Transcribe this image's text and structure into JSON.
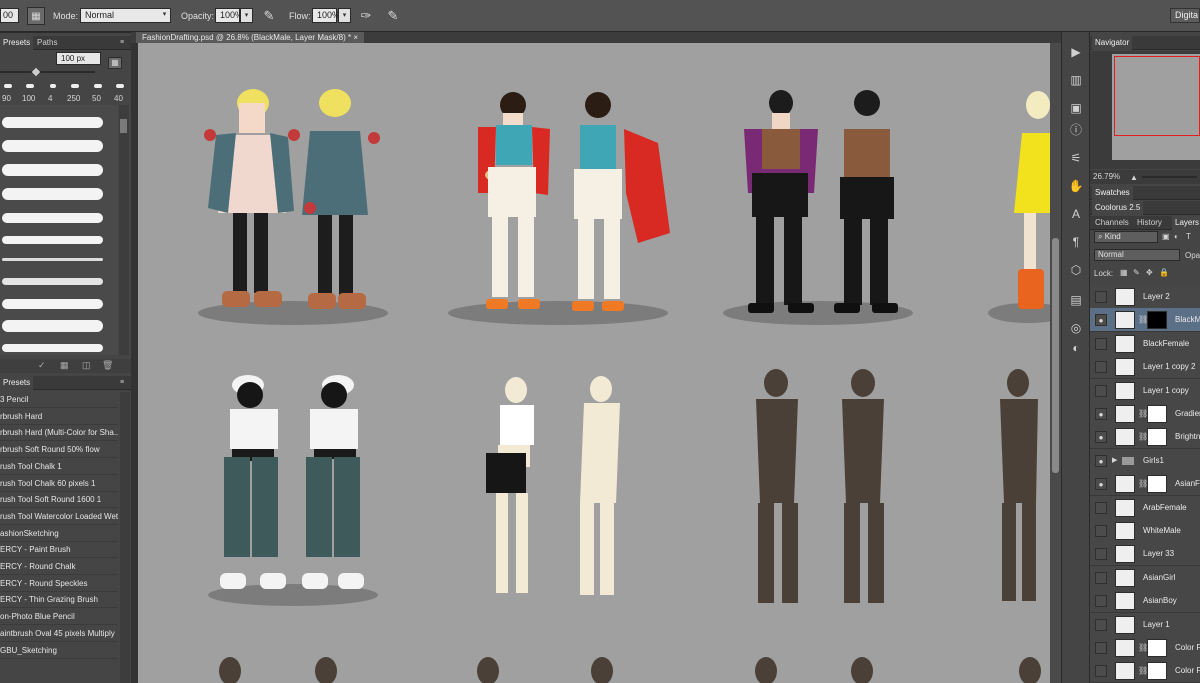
{
  "options_bar": {
    "brush_size": "00",
    "mode_label": "Mode:",
    "mode_value": "Normal",
    "opacity_label": "Opacity:",
    "opacity_value": "100%",
    "flow_label": "Flow:",
    "flow_value": "100%",
    "workspace": "Digita"
  },
  "brush_presets_panel": {
    "tabs": [
      "Presets",
      "Paths"
    ],
    "size_value": "100 px",
    "size_numbers": [
      "90",
      "100",
      "4",
      "250",
      "50",
      "40"
    ]
  },
  "tool_presets_panel": {
    "tab": "Presets",
    "items": [
      "3 Pencil",
      "rbrush Hard",
      "rbrush Hard (Multi-Color for Sha...",
      "rbrush Soft Round 50% flow",
      "rush Tool Chalk 1",
      "rush Tool Chalk 60 pixels 1",
      "rush Tool Soft Round 1600 1",
      "rush Tool Watercolor Loaded Wet...",
      "ashionSketching",
      "ERCY - Paint Brush",
      "ERCY - Round Chalk",
      "ERCY - Round Speckles",
      "ERCY - Thin Grazing Brush",
      "on-Photo Blue Pencil",
      "aintbrush Oval 45 pixels Multiply",
      "GBU_Sketching"
    ]
  },
  "document": {
    "tab_title": "FashionDrafting.psd @ 26.8% (BlackMale, Layer Mask/8) *",
    "close": "×"
  },
  "navigator": {
    "title": "Navigator",
    "zoom": "26.79%"
  },
  "swatches": {
    "title": "Swatches"
  },
  "coolorus": {
    "title": "Coolorus 2.5"
  },
  "layers_panel": {
    "tabs": [
      "Channels",
      "History",
      "Layers"
    ],
    "filter": "Kind",
    "blend_mode": "Normal",
    "opacity_label": "Opa",
    "lock_label": "Lock:",
    "layers": [
      {
        "name": "Layer 2",
        "visible": false,
        "mask": false,
        "selected": false
      },
      {
        "name": "BlackM",
        "visible": true,
        "mask": true,
        "selected": true
      },
      {
        "name": "BlackFemale",
        "visible": false,
        "mask": false,
        "selected": false
      },
      {
        "name": "Layer 1 copy 2",
        "visible": false,
        "mask": false,
        "selected": false
      },
      {
        "name": "Layer 1 copy",
        "visible": false,
        "mask": false,
        "selected": false
      },
      {
        "name": "Gradien",
        "visible": true,
        "mask": true,
        "selected": false
      },
      {
        "name": "Brightn",
        "visible": true,
        "mask": true,
        "selected": false
      },
      {
        "name": "Girls1",
        "visible": true,
        "mask": false,
        "selected": false
      },
      {
        "name": "AsianFe",
        "visible": true,
        "mask": true,
        "selected": false
      },
      {
        "name": "ArabFemale",
        "visible": false,
        "mask": false,
        "selected": false
      },
      {
        "name": "WhiteMale",
        "visible": false,
        "mask": false,
        "selected": false
      },
      {
        "name": "Layer 33",
        "visible": false,
        "mask": false,
        "selected": false
      },
      {
        "name": "AsianGirl",
        "visible": false,
        "mask": false,
        "selected": false
      },
      {
        "name": "AsianBoy",
        "visible": false,
        "mask": false,
        "selected": false
      },
      {
        "name": "Layer 1",
        "visible": false,
        "mask": false,
        "selected": false
      },
      {
        "name": "Color F",
        "visible": false,
        "mask": true,
        "selected": false
      },
      {
        "name": "Color F",
        "visible": false,
        "mask": true,
        "selected": false
      }
    ]
  },
  "icons": {
    "eye": "●",
    "folder_arrow": "▶",
    "dropdown": "▾"
  }
}
